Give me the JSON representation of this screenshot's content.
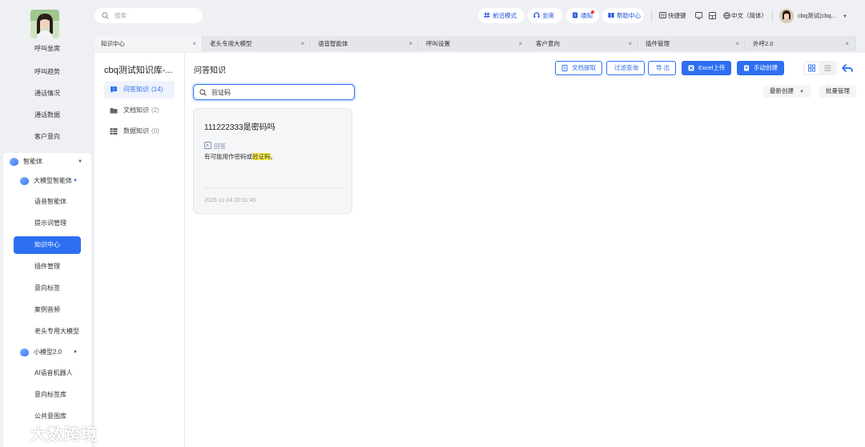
{
  "sidebar": {
    "items_top": [
      "呼叫坐席",
      "呼叫趋势",
      "通话情况",
      "通话数据",
      "客户意向"
    ],
    "agent_group": "智能体",
    "llm_group": "大模型智能体",
    "llm_items": [
      "语音智能体",
      "提示词管理",
      "知识中心",
      "插件管理",
      "意向标签",
      "案例音频",
      "老头专用大模型"
    ],
    "active_item": "知识中心",
    "small_group": "小模型2.0",
    "small_items": [
      "AI语音机器人",
      "意向标签库",
      "公共意图库"
    ]
  },
  "topbar": {
    "search_placeholder": "搜索",
    "frontier": "前沿模式",
    "seat": "坐席",
    "notify": "通知",
    "help": "帮助中心",
    "shortcut": "快捷键",
    "language": "中文（简体）",
    "user": "cbq测试(cbq..."
  },
  "tabs": [
    "知识中心",
    "老头专用大模型",
    "语音智能体",
    "呼叫设置",
    "客户意向",
    "插件管理",
    "外呼2.0"
  ],
  "kb": {
    "title": "cbq测试知识库-...",
    "items": [
      {
        "label": "问答知识",
        "count": "(14)"
      },
      {
        "label": "文档知识",
        "count": "(2)"
      },
      {
        "label": "数据知识",
        "count": "(0)"
      }
    ]
  },
  "main": {
    "title": "问答知识",
    "buttons": {
      "doc_extract": "文档提取",
      "filter": "过滤查询",
      "export": "导 出",
      "excel_upload": "Excel上传",
      "manual_create": "手动创建"
    },
    "search_value": "验证码",
    "sort_label": "最新创建",
    "batch_label": "批量管理"
  },
  "qa_card": {
    "question": "111222333是密码吗",
    "answer_label": "回答",
    "answer_prefix": "有可能用作密码或",
    "answer_highlight": "验证码",
    "answer_suffix": "。",
    "time": "2025-11-24 20:31:45"
  },
  "brand": "大数跨境",
  "colors": {
    "accent": "#2e6ff2",
    "highlight": "#fff24d"
  }
}
